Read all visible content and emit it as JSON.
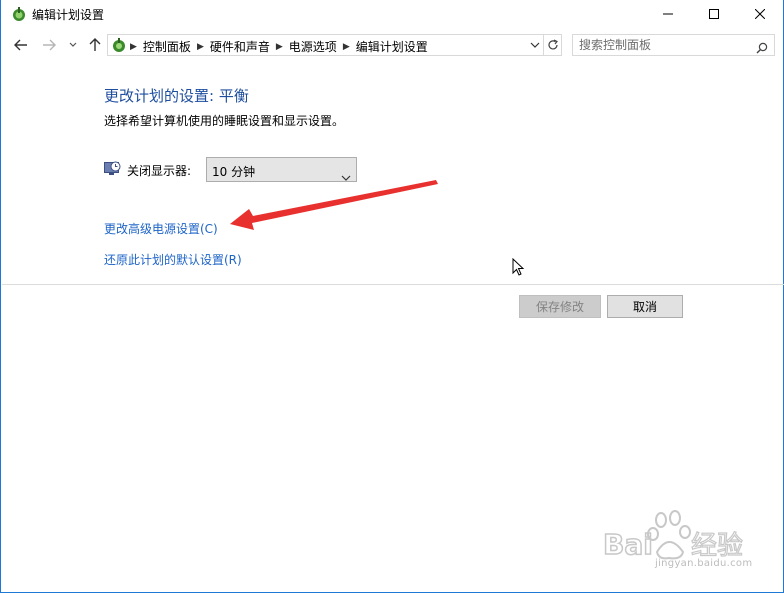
{
  "window": {
    "title": "编辑计划设置"
  },
  "address_bar": {
    "breadcrumbs": [
      "控制面板",
      "硬件和声音",
      "电源选项",
      "编辑计划设置"
    ]
  },
  "search": {
    "placeholder": "搜索控制面板"
  },
  "main": {
    "heading": "更改计划的设置: 平衡",
    "subtitle": "选择希望计算机使用的睡眠设置和显示设置。",
    "display_off": {
      "label": "关闭显示器:",
      "value": "10 分钟"
    },
    "link_advanced": "更改高级电源设置(C)",
    "link_restore": "还原此计划的默认设置(R)"
  },
  "buttons": {
    "save": "保存修改",
    "cancel": "取消"
  },
  "watermark": {
    "brand": "Bai 经验",
    "url": "jingyan.baidu.com"
  },
  "colors": {
    "heading": "#1e4e9e",
    "link": "#1e64c8",
    "annotation_arrow": "#e8312f",
    "window_border": "#1e78d6"
  },
  "icons": [
    "power-options-icon",
    "minimize-icon",
    "maximize-icon",
    "close-icon",
    "back-arrow-icon",
    "forward-arrow-icon",
    "recent-dropdown-icon",
    "up-arrow-icon",
    "refresh-icon",
    "search-icon",
    "monitor-clock-icon",
    "chevron-down-icon"
  ]
}
